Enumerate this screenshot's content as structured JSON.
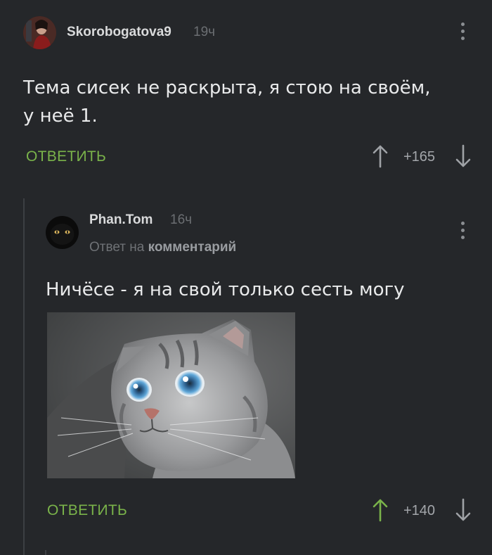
{
  "comment1": {
    "username": "Skorobogatova9",
    "time": "19ч",
    "text_line1": "Тема сисек не раскрыта, я стою на своём,",
    "text_line2": "у неё 1.",
    "reply_label": "ОТВЕТИТЬ",
    "rating": "+165"
  },
  "comment2": {
    "username": "Phan.Tom",
    "time": "16ч",
    "reply_to_prefix": "Ответ на",
    "reply_to_link": "комментарий",
    "text": "Ничёсе - я на свой только сесть могу",
    "reply_label": "ОТВЕТИТЬ",
    "rating": "+140",
    "upvoted": true
  },
  "colors": {
    "background": "#25272a",
    "accent_green": "#7ab34a",
    "text": "#e9eaeb",
    "muted": "#6b6e72"
  }
}
